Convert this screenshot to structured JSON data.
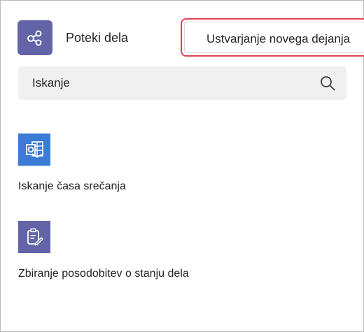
{
  "header": {
    "app_icon": "share-nodes-icon",
    "title": "Poteki dela",
    "create_button_label": "Ustvarjanje novega dejanja"
  },
  "search": {
    "placeholder": "Iskanje",
    "icon": "search-icon"
  },
  "templates": [
    {
      "label": "Iskanje časa srečanja",
      "icon": "outlook-calendar-icon",
      "color": "#3a7bd5"
    },
    {
      "label": "Zbiranje posodobitev o stanju dela",
      "icon": "clipboard-edit-icon",
      "color": "#6264a7"
    }
  ],
  "colors": {
    "accent": "#6264a7",
    "highlight_border": "#e0454f"
  }
}
